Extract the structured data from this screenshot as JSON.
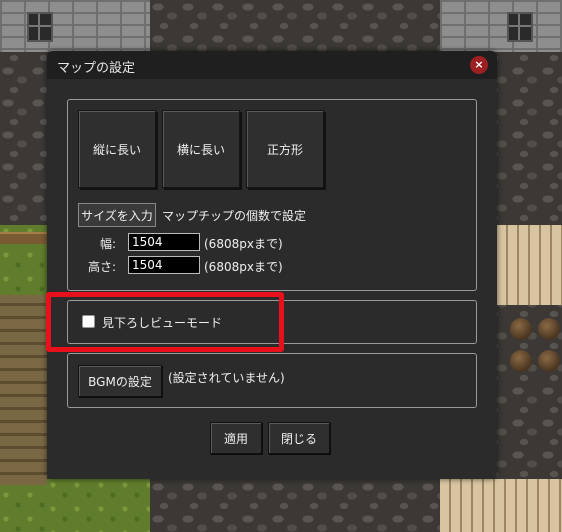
{
  "dialog": {
    "title": "マップの設定",
    "close_icon": "×"
  },
  "shape_buttons": [
    {
      "label": "縦に長い"
    },
    {
      "label": "横に長い"
    },
    {
      "label": "正方形"
    }
  ],
  "size": {
    "input_button_label": "サイズを入力",
    "chip_label": "マップチップの個数で設定",
    "width_label": "幅:",
    "width_value": "1504",
    "width_max": "(6808pxまで)",
    "height_label": "高さ:",
    "height_value": "1504",
    "height_max": "(6808pxまで)"
  },
  "view_mode": {
    "checked": false,
    "label": "見下ろしビューモード"
  },
  "bgm": {
    "button_label": "BGMの設定",
    "status": "(設定されていません)"
  },
  "footer": {
    "apply_label": "適用",
    "close_label": "閉じる"
  },
  "colors": {
    "highlight": "#e8101a",
    "close_button": "#9c1f22"
  }
}
